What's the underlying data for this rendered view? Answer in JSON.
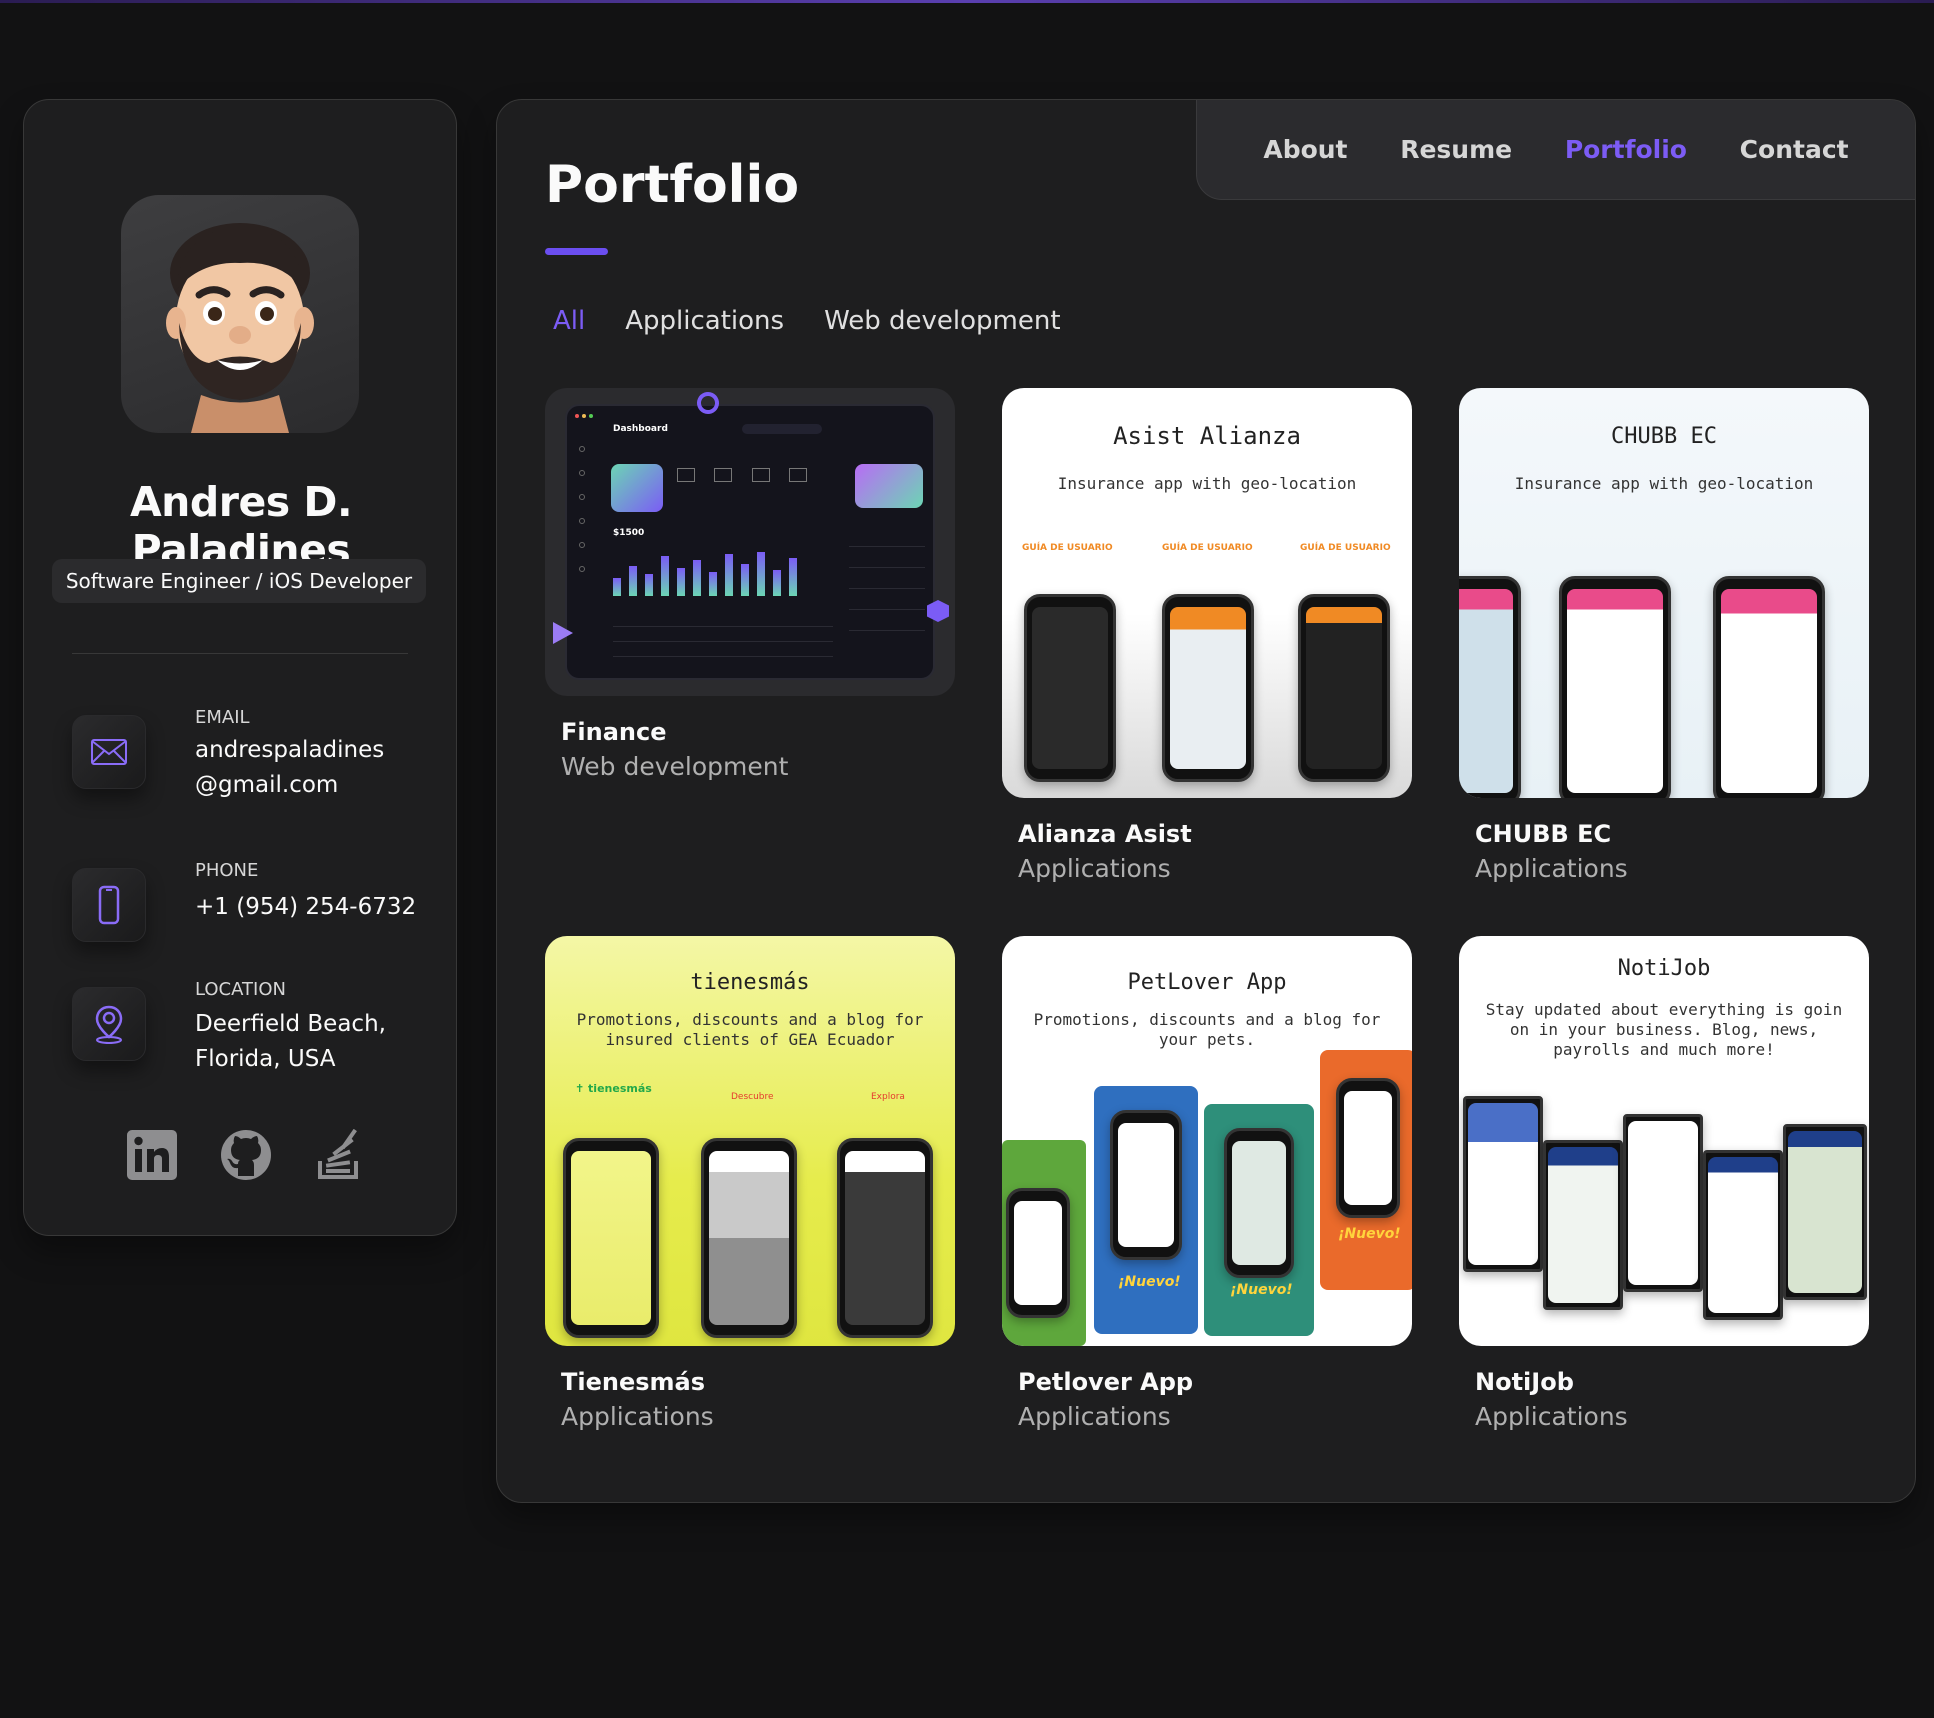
{
  "profile": {
    "name": "Andres D. Paladines",
    "title": "Software Engineer / iOS Developer",
    "contacts": [
      {
        "label": "Email",
        "value": "andrespaladines @gmail.com",
        "icon": "mail-icon"
      },
      {
        "label": "Phone",
        "value": "+1 (954) 254-6732",
        "icon": "phone-icon"
      },
      {
        "label": "Location",
        "value": "Deerfield Beach, Florida, USA",
        "icon": "location-icon"
      }
    ],
    "socials": [
      "linkedin-icon",
      "github-icon",
      "stackoverflow-icon"
    ]
  },
  "nav": {
    "items": [
      "About",
      "Resume",
      "Portfolio",
      "Contact"
    ],
    "active": "Portfolio"
  },
  "page": {
    "title": "Portfolio",
    "filters": [
      "All",
      "Applications",
      "Web development"
    ],
    "active_filter": "All"
  },
  "projects": [
    {
      "name": "Finance",
      "category": "Web development"
    },
    {
      "name": "Alianza Asist",
      "category": "Applications",
      "thumb_title": "Asist Alianza",
      "thumb_sub": "Insurance app with geo-location",
      "guides": [
        "GUÍA DE USUARIO",
        "GUÍA DE USUARIO",
        "GUÍA DE USUARIO"
      ]
    },
    {
      "name": "CHUBB EC",
      "category": "Applications",
      "thumb_title": "CHUBB EC",
      "thumb_sub": "Insurance app with geo-location"
    },
    {
      "name": "Tienesmás",
      "category": "Applications",
      "thumb_title": "tienesmás",
      "thumb_sub": "Promotions, discounts and a blog for insured clients of GEA Ecuador",
      "labels": [
        "Descubre",
        "Explora"
      ]
    },
    {
      "name": "Petlover App",
      "category": "Applications",
      "thumb_title": "PetLover App",
      "thumb_sub": "Promotions, discounts and a blog for your pets.",
      "badge": "¡Nuevo!"
    },
    {
      "name": "NotiJob",
      "category": "Applications",
      "thumb_title": "NotiJob",
      "thumb_sub": "Stay updated about everything is goin on in your business. Blog, news, payrolls and much more!"
    }
  ],
  "finance_thumb": {
    "header": "Dashboard",
    "balance": "$1500"
  },
  "colors": {
    "accent": "#7c5cf5",
    "panel": "#1e1e1f",
    "background": "#121213"
  }
}
